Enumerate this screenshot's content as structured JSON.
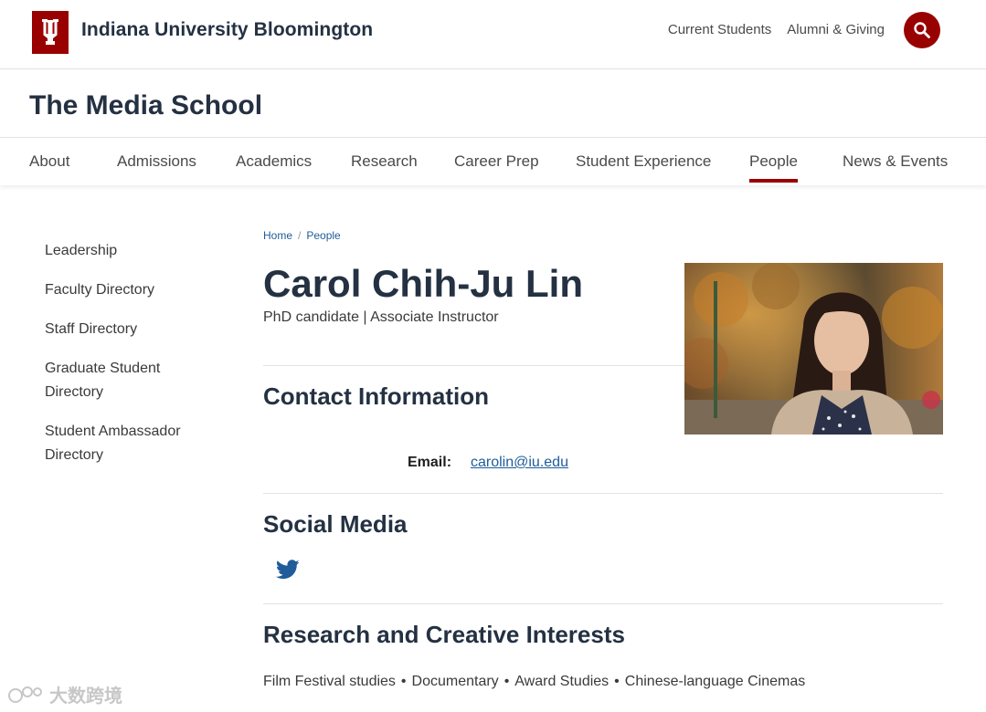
{
  "header": {
    "university": "Indiana University Bloomington",
    "links": [
      "Current Students",
      "Alumni & Giving"
    ],
    "brand_color": "#990000"
  },
  "site": {
    "title": "The Media School"
  },
  "nav": {
    "items": [
      "About",
      "Admissions",
      "Academics",
      "Research",
      "Career Prep",
      "Student Experience",
      "People",
      "News & Events"
    ],
    "active": "People"
  },
  "sidebar": {
    "items": [
      "Leadership",
      "Faculty Directory",
      "Staff Directory",
      "Graduate Student Directory",
      "Student Ambassador Directory"
    ]
  },
  "breadcrumb": {
    "items": [
      "Home",
      "People"
    ],
    "separator": "/"
  },
  "profile": {
    "name": "Carol Chih-Ju Lin",
    "title": "PhD candidate | Associate Instructor",
    "contact_heading": "Contact Information",
    "email_label": "Email:",
    "email": "carolin@iu.edu",
    "social_heading": "Social Media",
    "social_icons": [
      "twitter-icon"
    ],
    "interests_heading": "Research and Creative Interests",
    "interests": [
      "Film Festival studies",
      "Documentary",
      "Award Studies",
      "Chinese-language Cinemas"
    ]
  },
  "watermark": {
    "text": "大数跨境"
  }
}
